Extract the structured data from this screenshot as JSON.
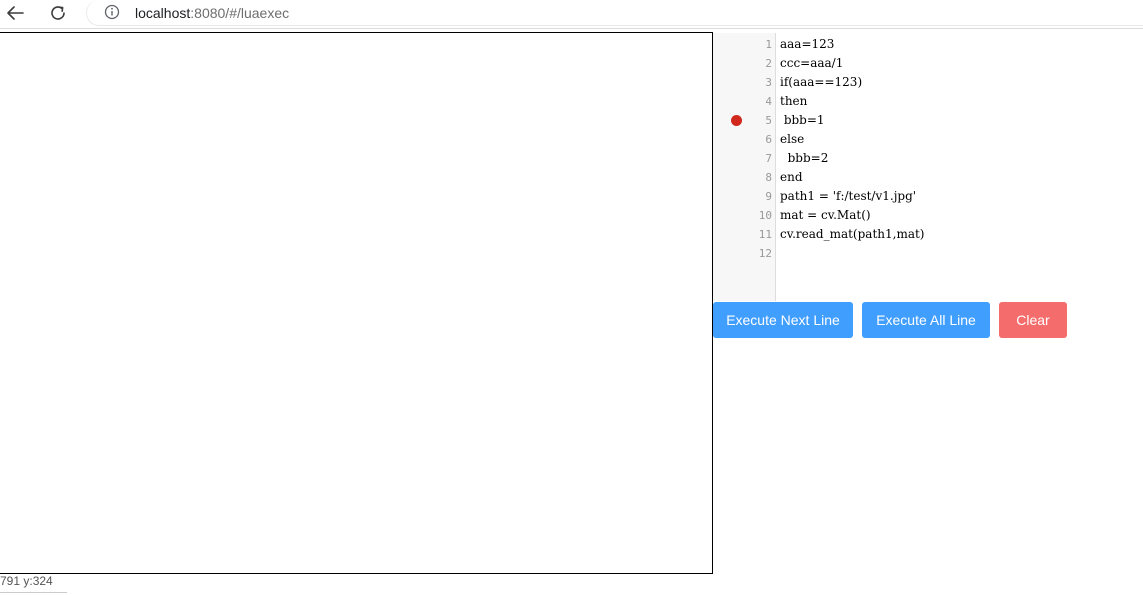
{
  "browser": {
    "url_host": "localhost",
    "url_rest": ":8080/#/luaexec",
    "back_icon": "arrow-left-icon",
    "reload_icon": "reload-icon",
    "info_icon": "info-icon"
  },
  "canvas": {
    "coords_text": "791 y:324"
  },
  "editor": {
    "lines": [
      {
        "num": "1",
        "text": "aaa=123",
        "breakpoint": false
      },
      {
        "num": "2",
        "text": "ccc=aaa/1",
        "breakpoint": false
      },
      {
        "num": "3",
        "text": "if(aaa==123)",
        "breakpoint": false
      },
      {
        "num": "4",
        "text": "then",
        "breakpoint": false
      },
      {
        "num": "5",
        "text": " bbb=1",
        "breakpoint": true
      },
      {
        "num": "6",
        "text": "else",
        "breakpoint": false
      },
      {
        "num": "7",
        "text": "  bbb=2",
        "breakpoint": false
      },
      {
        "num": "8",
        "text": "end",
        "breakpoint": false
      },
      {
        "num": "9",
        "text": "path1 = 'f:/test/v1.jpg'",
        "breakpoint": false
      },
      {
        "num": "10",
        "text": "mat = cv.Mat()",
        "breakpoint": false
      },
      {
        "num": "11",
        "text": "cv.read_mat(path1,mat)",
        "breakpoint": false
      },
      {
        "num": "12",
        "text": "",
        "breakpoint": false
      }
    ],
    "breakpoint_color": "#d1281d"
  },
  "buttons": {
    "next_label": "Execute Next Line",
    "all_label": "Execute All Line",
    "clear_label": "Clear",
    "primary_color": "#409eff",
    "danger_color": "#f56c6c"
  }
}
